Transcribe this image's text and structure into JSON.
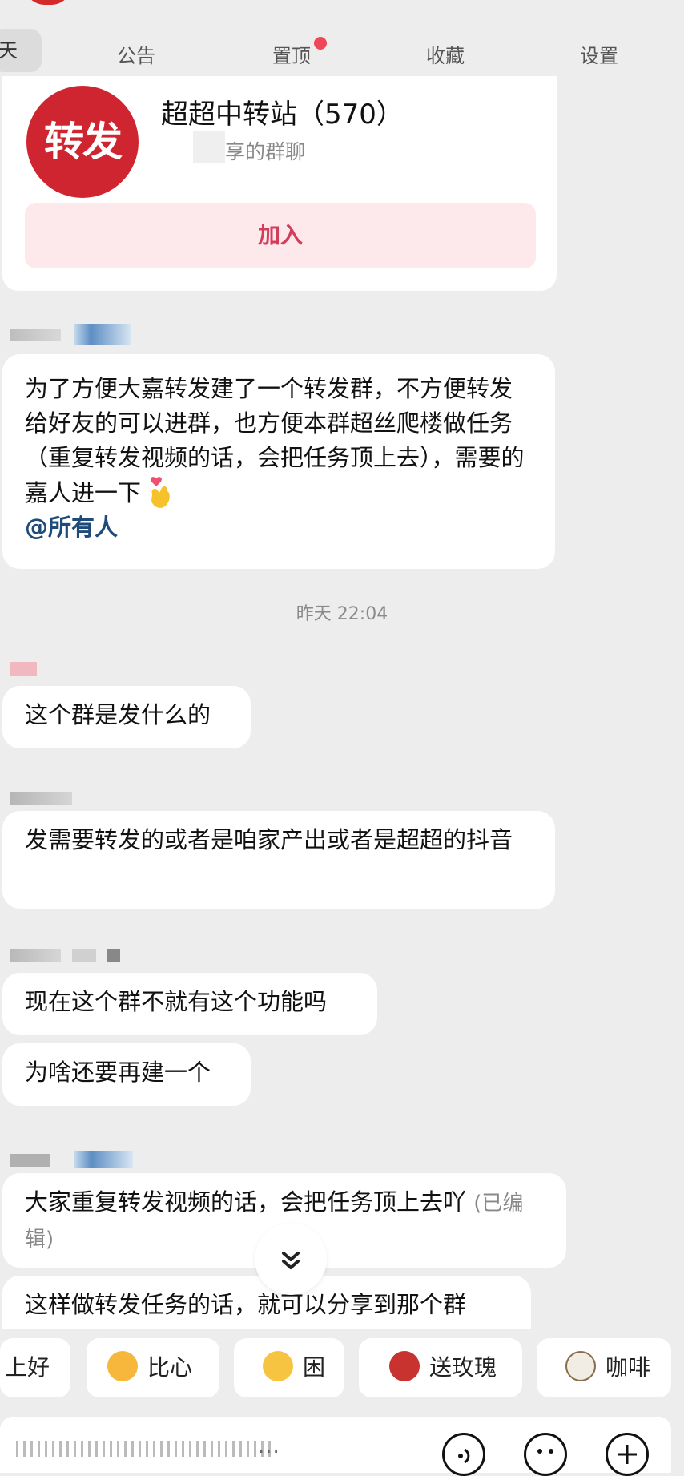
{
  "tabs": [
    {
      "label": "天"
    },
    {
      "label": "公告"
    },
    {
      "label": "置顶"
    },
    {
      "label": "收藏"
    },
    {
      "label": "设置"
    }
  ],
  "group_card": {
    "logo_text": "转发",
    "name": "超超中转站（570）",
    "subtitle": "享的群聊",
    "join_label": "加入"
  },
  "messages": [
    {
      "text": "为了方便大嘉转发建了一个转发群，不方便转发给好友的可以进群，也方便本群超丝爬楼做任务（重复转发视频的话，会把任务顶上去），需要的嘉人进一下",
      "mention": "@所有人"
    },
    {
      "text": "这个群是发什么的"
    },
    {
      "text": "发需要转发的或者是咱家产出或者是超超的抖音"
    },
    {
      "text": "现在这个群不就有这个功能吗"
    },
    {
      "text": "为啥还要再建一个"
    },
    {
      "text": "大家重复转发视频的话，会把任务顶上去吖",
      "edited": "(已编辑)"
    },
    {
      "text": "这样做转发任务的话，就可以分享到那个群"
    }
  ],
  "timestamp": "昨天 22:04",
  "quick_replies": [
    {
      "label": "上好"
    },
    {
      "label": "比心",
      "icon": "finger-heart-emoji"
    },
    {
      "label": "困",
      "icon": "sleepy-face-emoji"
    },
    {
      "label": "送玫瑰",
      "icon": "rose-emoji"
    },
    {
      "label": "咖啡",
      "icon": "coffee-emoji"
    }
  ],
  "input": {
    "placeholder": "..."
  },
  "colors": {
    "background": "#ededed",
    "accent_red": "#cf2530",
    "join_bg": "#fde9ec",
    "join_text": "#d43d5a",
    "mention": "#1f4b7a",
    "unread_dot": "#f0465a"
  }
}
